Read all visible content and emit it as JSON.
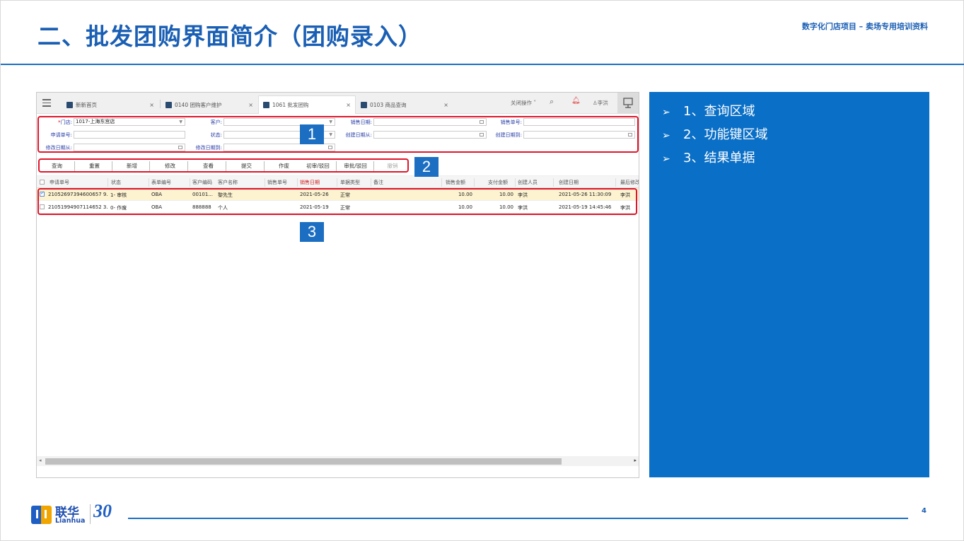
{
  "slide": {
    "title": "二、批发团购界面简介（团购录入）",
    "subtitle": "数字化门店项目 – 卖场专用培训资料",
    "page_number": "4"
  },
  "app": {
    "tabs": [
      {
        "label": "新新首页",
        "close": "×"
      },
      {
        "label": "0140 团购客户维护",
        "close": "×"
      },
      {
        "label": "1061 批发团购",
        "close": "×"
      },
      {
        "label": "0103 商品查询",
        "close": "×"
      }
    ],
    "topbar": {
      "close_ops": "关闭操作 ˅",
      "user": "李洪"
    },
    "query": {
      "store_label": "门店:",
      "store_required": "*",
      "store_value": "1017-上海东宫店",
      "customer_label": "客户:",
      "sales_date_label": "销售日期:",
      "sales_no_label": "销售单号:",
      "apply_no_label": "申请单号:",
      "status_label": "状态:",
      "create_from_label": "创建日期从:",
      "create_to_label": "创建日期到:",
      "modify_from_label": "修改日期从:",
      "modify_to_label": "修改日期到:"
    },
    "buttons": [
      "查询",
      "重置",
      "新增",
      "修改",
      "查看",
      "提交",
      "作废",
      "初审/驳回",
      "审批/驳回",
      "撤销"
    ],
    "columns": [
      "申请单号",
      "状态",
      "表单编号",
      "客户编码",
      "客户名称",
      "销售单号",
      "销售日期",
      "单据类型",
      "备注",
      "销售金额",
      "支付金额",
      "创建人员",
      "创建日期",
      "最后修改"
    ],
    "rows": [
      {
        "apply_no": "21052697394600657 9...",
        "status": "1- 审核",
        "form_no": "OBA",
        "cust_code": "00101...",
        "cust_name": "黎先生",
        "sales_no": "",
        "sales_date": "2021-05-26",
        "type": "正常",
        "note": "",
        "sales_amt": "10.00",
        "pay_amt": "10.00",
        "creator": "李洪",
        "create_date": "2021-05-26 11:30:09",
        "last_mod": "李洪"
      },
      {
        "apply_no": "21051994907114652 3...",
        "status": "0- 作废",
        "form_no": "OBA",
        "cust_code": "888888",
        "cust_name": "个人",
        "sales_no": "",
        "sales_date": "2021-05-19",
        "type": "正常",
        "note": "",
        "sales_amt": "10.00",
        "pay_amt": "10.00",
        "creator": "李洪",
        "create_date": "2021-05-19 14:45:46",
        "last_mod": "李洪"
      }
    ],
    "callouts": [
      "1",
      "2",
      "3"
    ]
  },
  "info": {
    "items": [
      "1、查询区域",
      "2、功能键区域",
      "3、结果单据"
    ]
  },
  "footer": {
    "brand_cn": "联华",
    "brand_en": "Lianhua",
    "anniversary": "30"
  }
}
